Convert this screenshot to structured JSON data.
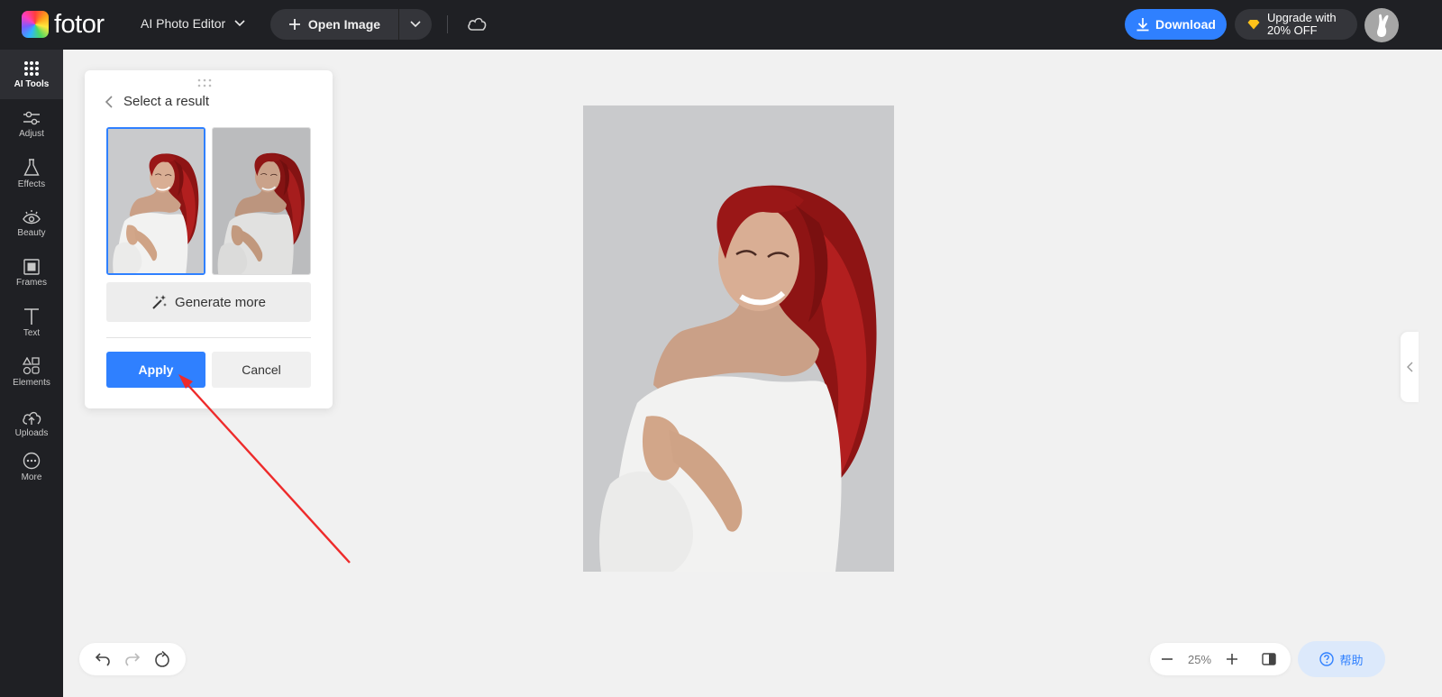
{
  "app": {
    "brand": "fotor",
    "editor_menu": "AI Photo Editor"
  },
  "toolbar": {
    "open_image": "Open Image",
    "download": "Download",
    "upgrade_line1": "Upgrade with",
    "upgrade_line2": "20% OFF"
  },
  "sidebar": {
    "items": [
      {
        "label": "AI Tools",
        "icon": "grid-dots-icon"
      },
      {
        "label": "Adjust",
        "icon": "sliders-icon"
      },
      {
        "label": "Effects",
        "icon": "flask-icon"
      },
      {
        "label": "Beauty",
        "icon": "eye-icon"
      },
      {
        "label": "Frames",
        "icon": "frame-icon"
      },
      {
        "label": "Text",
        "icon": "text-icon"
      },
      {
        "label": "Elements",
        "icon": "shapes-icon"
      },
      {
        "label": "Uploads",
        "icon": "cloud-upload-icon"
      },
      {
        "label": "More",
        "icon": "more-icon"
      }
    ]
  },
  "panel": {
    "title": "Select a result",
    "generate_more": "Generate more",
    "apply": "Apply",
    "cancel": "Cancel"
  },
  "zoom": {
    "value": "25%"
  },
  "help": {
    "label": "帮助"
  },
  "colors": {
    "accent": "#2f80ff",
    "dark_bg": "#1f2024",
    "canvas_bg": "#f1f1f1",
    "hair": "#a61b1b"
  }
}
